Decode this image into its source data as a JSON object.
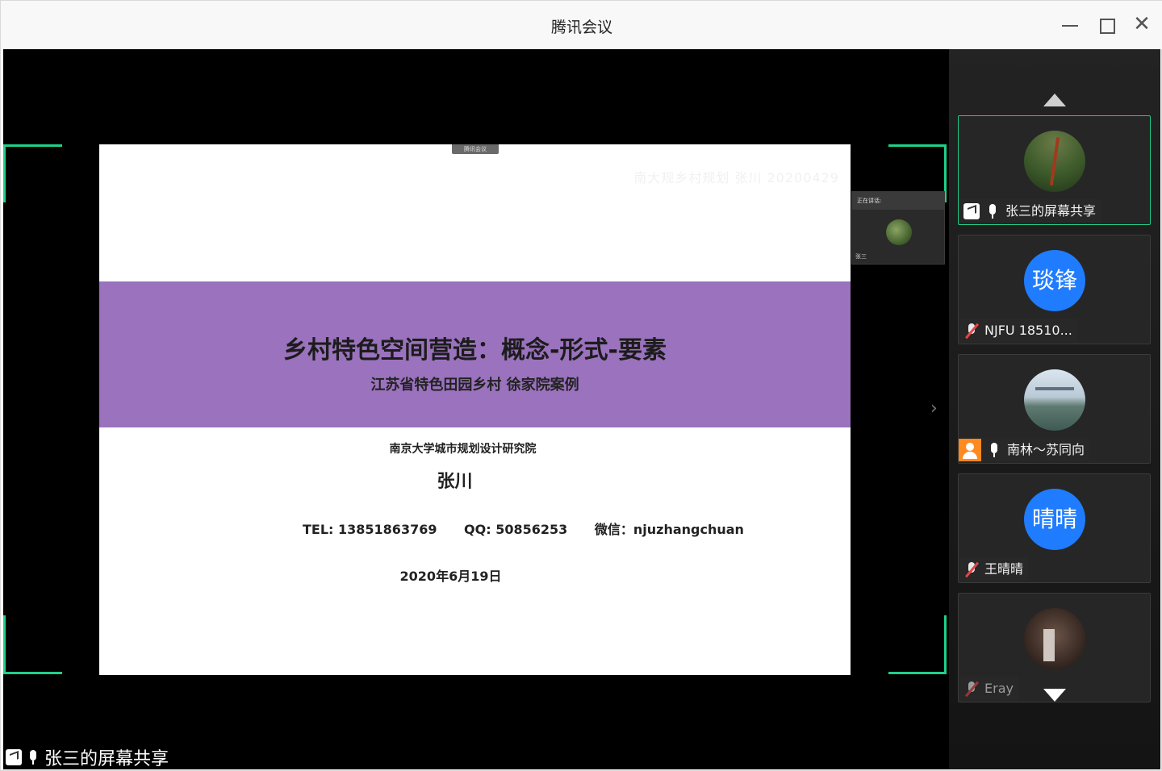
{
  "window": {
    "title": "腾讯会议",
    "close_glyph": "✕"
  },
  "slide": {
    "top_tag": "腾讯会议",
    "watermark": "南大规乡村规划 张川 20200429",
    "title": "乡村特色空间营造：概念-形式-要素",
    "subtitle": "江苏省特色田园乡村 徐家院案例",
    "institute": "南京大学城市规划设计研究院",
    "author": "张川",
    "tel": "TEL:   13851863769",
    "qq": "QQ:   50856253",
    "wechat": "微信：njuzhangchuan",
    "date": "2020年6月19日"
  },
  "mini_view": {
    "header": "正在讲话:",
    "footer": "张三"
  },
  "stage": {
    "share_label": "张三的屏幕共享",
    "next_arrow": "›",
    "accent_color": "#1fd08a"
  },
  "participants": [
    {
      "name": "张三的屏幕共享",
      "avatar": "plant-photo",
      "mic": "on",
      "active": true
    },
    {
      "name": "NJFU 18510...",
      "avatar_text": "琰锋",
      "mic": "muted"
    },
    {
      "name": "南林～苏同向",
      "avatar": "city-photo",
      "mic": "on",
      "host": true
    },
    {
      "name": "王晴晴",
      "avatar_text": "晴晴",
      "mic": "muted"
    },
    {
      "name": "Eray",
      "avatar": "room-photo",
      "mic": "muted"
    }
  ]
}
